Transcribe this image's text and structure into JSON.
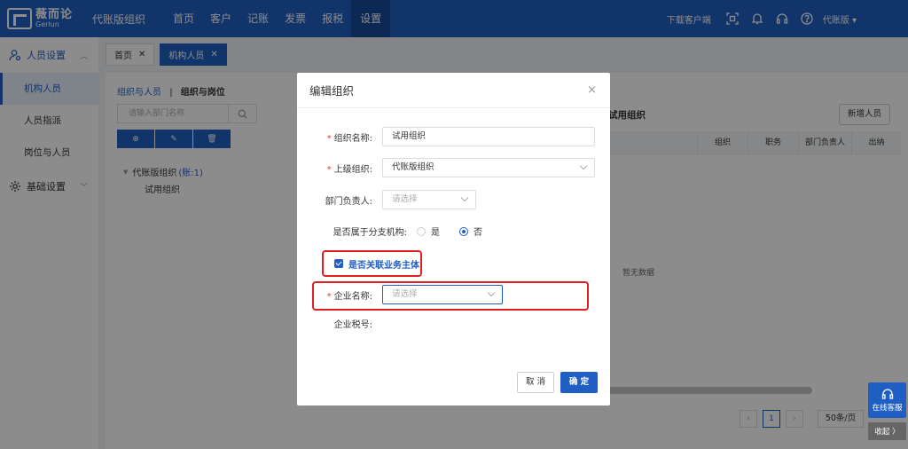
{
  "brand": {
    "name_cn": "薇而论",
    "name_en": "Gerlun"
  },
  "header": {
    "org_name": "代账版组织",
    "nav": [
      "首页",
      "客户",
      "记账",
      "发票",
      "报税",
      "设置"
    ],
    "download": "下载客户端",
    "edition": "代账版 ▾"
  },
  "sidebar": {
    "group1": "人员设置",
    "items": [
      "机构人员",
      "人员指派",
      "岗位与人员"
    ],
    "group2": "基础设置"
  },
  "tabs": [
    {
      "label": "首页"
    },
    {
      "label": "机构人员"
    }
  ],
  "content": {
    "crumb_link": "组织与人员",
    "crumb_sep": "|",
    "crumb_current": "组织与岗位",
    "dept_search_placeholder": "请输入部门名称",
    "tree_root": "代账版组织",
    "tree_root_acct": "(账:1)",
    "tree_child": "试用组织",
    "table_title": "试用组织",
    "new_button": "新增人员",
    "columns": [
      "组织",
      "职务",
      "部门负责人",
      "出纳"
    ],
    "empty_text": "暂无数据",
    "page_current": "1",
    "page_size": "50条/页"
  },
  "service": {
    "label": "在线客服",
    "collapse": "收起 〉"
  },
  "modal": {
    "title": "编辑组织",
    "close": "×",
    "org_name_label": "组织名称:",
    "org_name_value": "试用组织",
    "parent_label": "上级组织:",
    "parent_value": "代账版组织",
    "dept_head_label": "部门负责人:",
    "dept_head_placeholder": "请选择",
    "branch_label": "是否属于分支机构:",
    "branch_yes": "是",
    "branch_no": "否",
    "link_entity_label": "是否关联业务主体",
    "company_label": "企业名称:",
    "company_placeholder": "请选择",
    "tax_label": "企业税号:",
    "cancel": "取 消",
    "ok": "确 定",
    "accent": "#1f5fc3",
    "annotation_color": "#e02020"
  }
}
